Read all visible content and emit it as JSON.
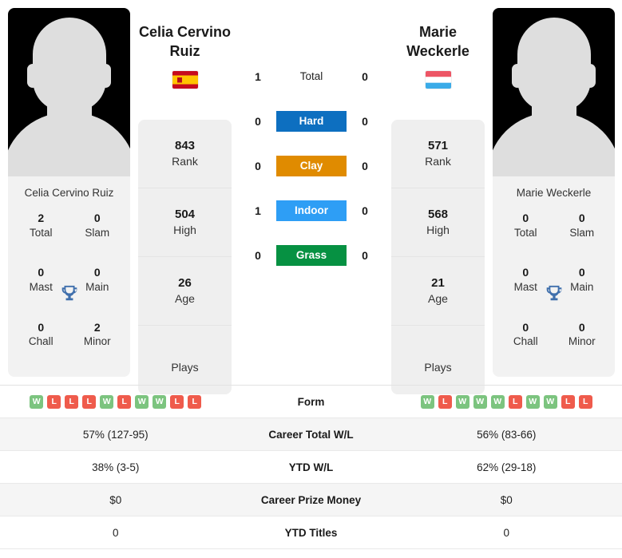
{
  "players": {
    "left": {
      "name": "Celia Cervino Ruiz",
      "name_line1": "Celia Cervino",
      "name_line2": "Ruiz",
      "flag": "spain-flag-icon",
      "avatar": "player-avatar-placeholder",
      "stats": [
        {
          "value": "843",
          "label": "Rank"
        },
        {
          "value": "504",
          "label": "High"
        },
        {
          "value": "26",
          "label": "Age"
        },
        {
          "value": "",
          "label": "Plays"
        }
      ],
      "titles": [
        {
          "value": "2",
          "label": "Total"
        },
        {
          "value": "0",
          "label": "Slam"
        },
        {
          "value": "0",
          "label": "Mast"
        },
        {
          "value": "0",
          "label": "Main"
        },
        {
          "value": "0",
          "label": "Chall"
        },
        {
          "value": "2",
          "label": "Minor"
        }
      ],
      "form": [
        "W",
        "L",
        "L",
        "L",
        "W",
        "L",
        "W",
        "W",
        "L",
        "L"
      ],
      "career_total_wl": "57% (127-95)",
      "ytd_wl": "38% (3-5)",
      "career_prize_money": "$0",
      "ytd_titles": "0"
    },
    "right": {
      "name": "Marie Weckerle",
      "name_line1": "Marie",
      "name_line2": "Weckerle",
      "flag": "luxembourg-flag-icon",
      "avatar": "player-avatar-placeholder",
      "stats": [
        {
          "value": "571",
          "label": "Rank"
        },
        {
          "value": "568",
          "label": "High"
        },
        {
          "value": "21",
          "label": "Age"
        },
        {
          "value": "",
          "label": "Plays"
        }
      ],
      "titles": [
        {
          "value": "0",
          "label": "Total"
        },
        {
          "value": "0",
          "label": "Slam"
        },
        {
          "value": "0",
          "label": "Mast"
        },
        {
          "value": "0",
          "label": "Main"
        },
        {
          "value": "0",
          "label": "Chall"
        },
        {
          "value": "0",
          "label": "Minor"
        }
      ],
      "form": [
        "W",
        "L",
        "W",
        "W",
        "W",
        "L",
        "W",
        "W",
        "L",
        "L"
      ],
      "career_total_wl": "56% (83-66)",
      "ytd_wl": "62% (29-18)",
      "career_prize_money": "$0",
      "ytd_titles": "0"
    }
  },
  "head_to_head": [
    {
      "label": "Total",
      "left": "1",
      "right": "0",
      "color": ""
    },
    {
      "label": "Hard",
      "left": "0",
      "right": "0",
      "color": "#0d6fc0"
    },
    {
      "label": "Clay",
      "left": "0",
      "right": "0",
      "color": "#e08b00"
    },
    {
      "label": "Indoor",
      "left": "1",
      "right": "0",
      "color": "#2e9ef5"
    },
    {
      "label": "Grass",
      "left": "0",
      "right": "0",
      "color": "#069142"
    }
  ],
  "table": {
    "rows": [
      {
        "label": "Form",
        "left": "",
        "right": ""
      },
      {
        "label": "Career Total W/L",
        "left": "57% (127-95)",
        "right": "56% (83-66)"
      },
      {
        "label": "YTD W/L",
        "left": "38% (3-5)",
        "right": "62% (29-18)"
      },
      {
        "label": "Career Prize Money",
        "left": "$0",
        "right": "$0"
      },
      {
        "label": "YTD Titles",
        "left": "0",
        "right": "0"
      }
    ]
  },
  "colors": {
    "win": "#7cc47f",
    "loss": "#ef5b4c",
    "hard": "#0d6fc0",
    "clay": "#e08b00",
    "indoor": "#2e9ef5",
    "grass": "#069142",
    "trophy": "#3f6fac",
    "card_bg": "#f2f2f2"
  }
}
